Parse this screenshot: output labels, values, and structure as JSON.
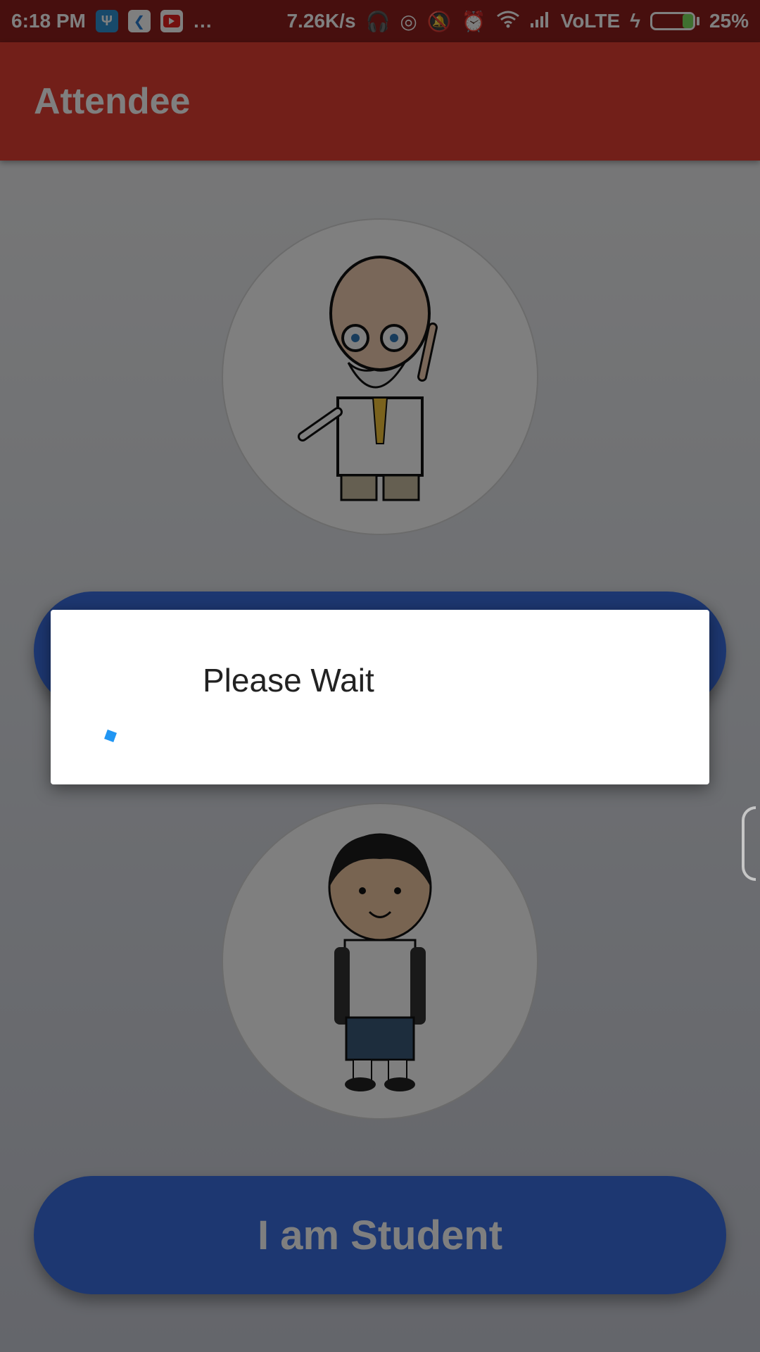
{
  "status_bar": {
    "time": "6:18 PM",
    "more": "…",
    "net_speed": "7.26K/s",
    "network": "VoLTE",
    "battery_percent": "25%",
    "battery_level": 0.25,
    "icons": [
      "usb-icon",
      "flutter-icon",
      "youtube-icon",
      "headset-icon",
      "hotspot-icon",
      "mute-icon",
      "alarm-icon",
      "wifi-icon",
      "signal-icon",
      "charging-icon",
      "battery-icon"
    ]
  },
  "app_bar": {
    "title": "Attendee"
  },
  "main": {
    "teacher_button_label": "",
    "student_button_label": "I am Student"
  },
  "dialog": {
    "message": "Please Wait"
  },
  "colors": {
    "status_bar": "#8f1f1c",
    "app_bar": "#e53e32",
    "button": "#3b6fe3",
    "spinner": "#2196f3"
  }
}
